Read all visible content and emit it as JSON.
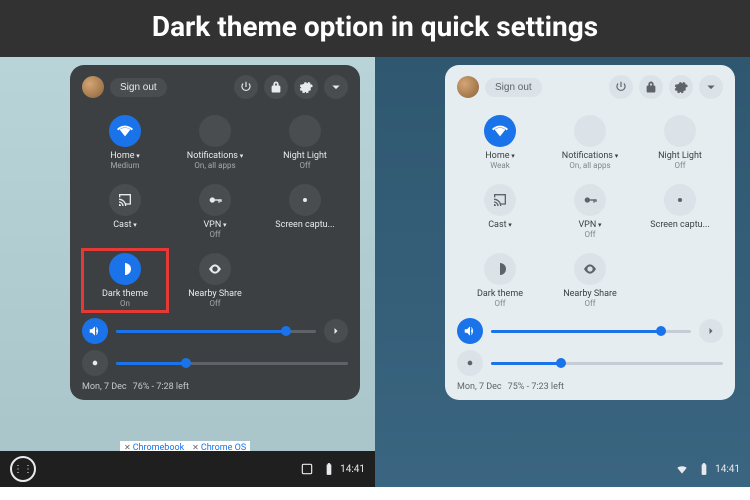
{
  "title": "Dark theme option in quick settings",
  "dark": {
    "signout": "Sign out",
    "tiles": [
      {
        "label": "Home",
        "sub": "Medium",
        "on": true,
        "caret": true
      },
      {
        "label": "Notifications",
        "sub": "On, all apps",
        "on": false,
        "caret": true
      },
      {
        "label": "Night Light",
        "sub": "Off",
        "on": false,
        "caret": false
      },
      {
        "label": "Cast",
        "sub": "",
        "on": false,
        "caret": true
      },
      {
        "label": "VPN",
        "sub": "Off",
        "on": false,
        "caret": true
      },
      {
        "label": "Screen captu...",
        "sub": "",
        "on": false,
        "caret": false
      },
      {
        "label": "Dark theme",
        "sub": "On",
        "on": true,
        "caret": false,
        "highlight": true
      },
      {
        "label": "Nearby Share",
        "sub": "Off",
        "on": false,
        "caret": false
      }
    ],
    "volume": 85,
    "brightness": 30,
    "date": "Mon, 7 Dec",
    "battery": "76% - 7:28 left",
    "clock": "14:41",
    "tags": [
      "Chromebook",
      "Chrome OS"
    ]
  },
  "light": {
    "signout": "Sign out",
    "tiles": [
      {
        "label": "Home",
        "sub": "Weak",
        "on": true,
        "caret": true
      },
      {
        "label": "Notifications",
        "sub": "On, all apps",
        "on": false,
        "caret": true
      },
      {
        "label": "Night Light",
        "sub": "Off",
        "on": false,
        "caret": false
      },
      {
        "label": "Cast",
        "sub": "",
        "on": false,
        "caret": true
      },
      {
        "label": "VPN",
        "sub": "Off",
        "on": false,
        "caret": true
      },
      {
        "label": "Screen captu...",
        "sub": "",
        "on": false,
        "caret": false
      },
      {
        "label": "Dark theme",
        "sub": "Off",
        "on": false,
        "caret": false
      },
      {
        "label": "Nearby Share",
        "sub": "Off",
        "on": false,
        "caret": false
      }
    ],
    "volume": 85,
    "brightness": 30,
    "date": "Mon, 7 Dec",
    "battery": "75% - 7:23 left",
    "clock": "14:41"
  },
  "icons": [
    "wifi",
    "dnd",
    "night",
    "cast",
    "vpn",
    "screen",
    "dark",
    "nearby"
  ]
}
